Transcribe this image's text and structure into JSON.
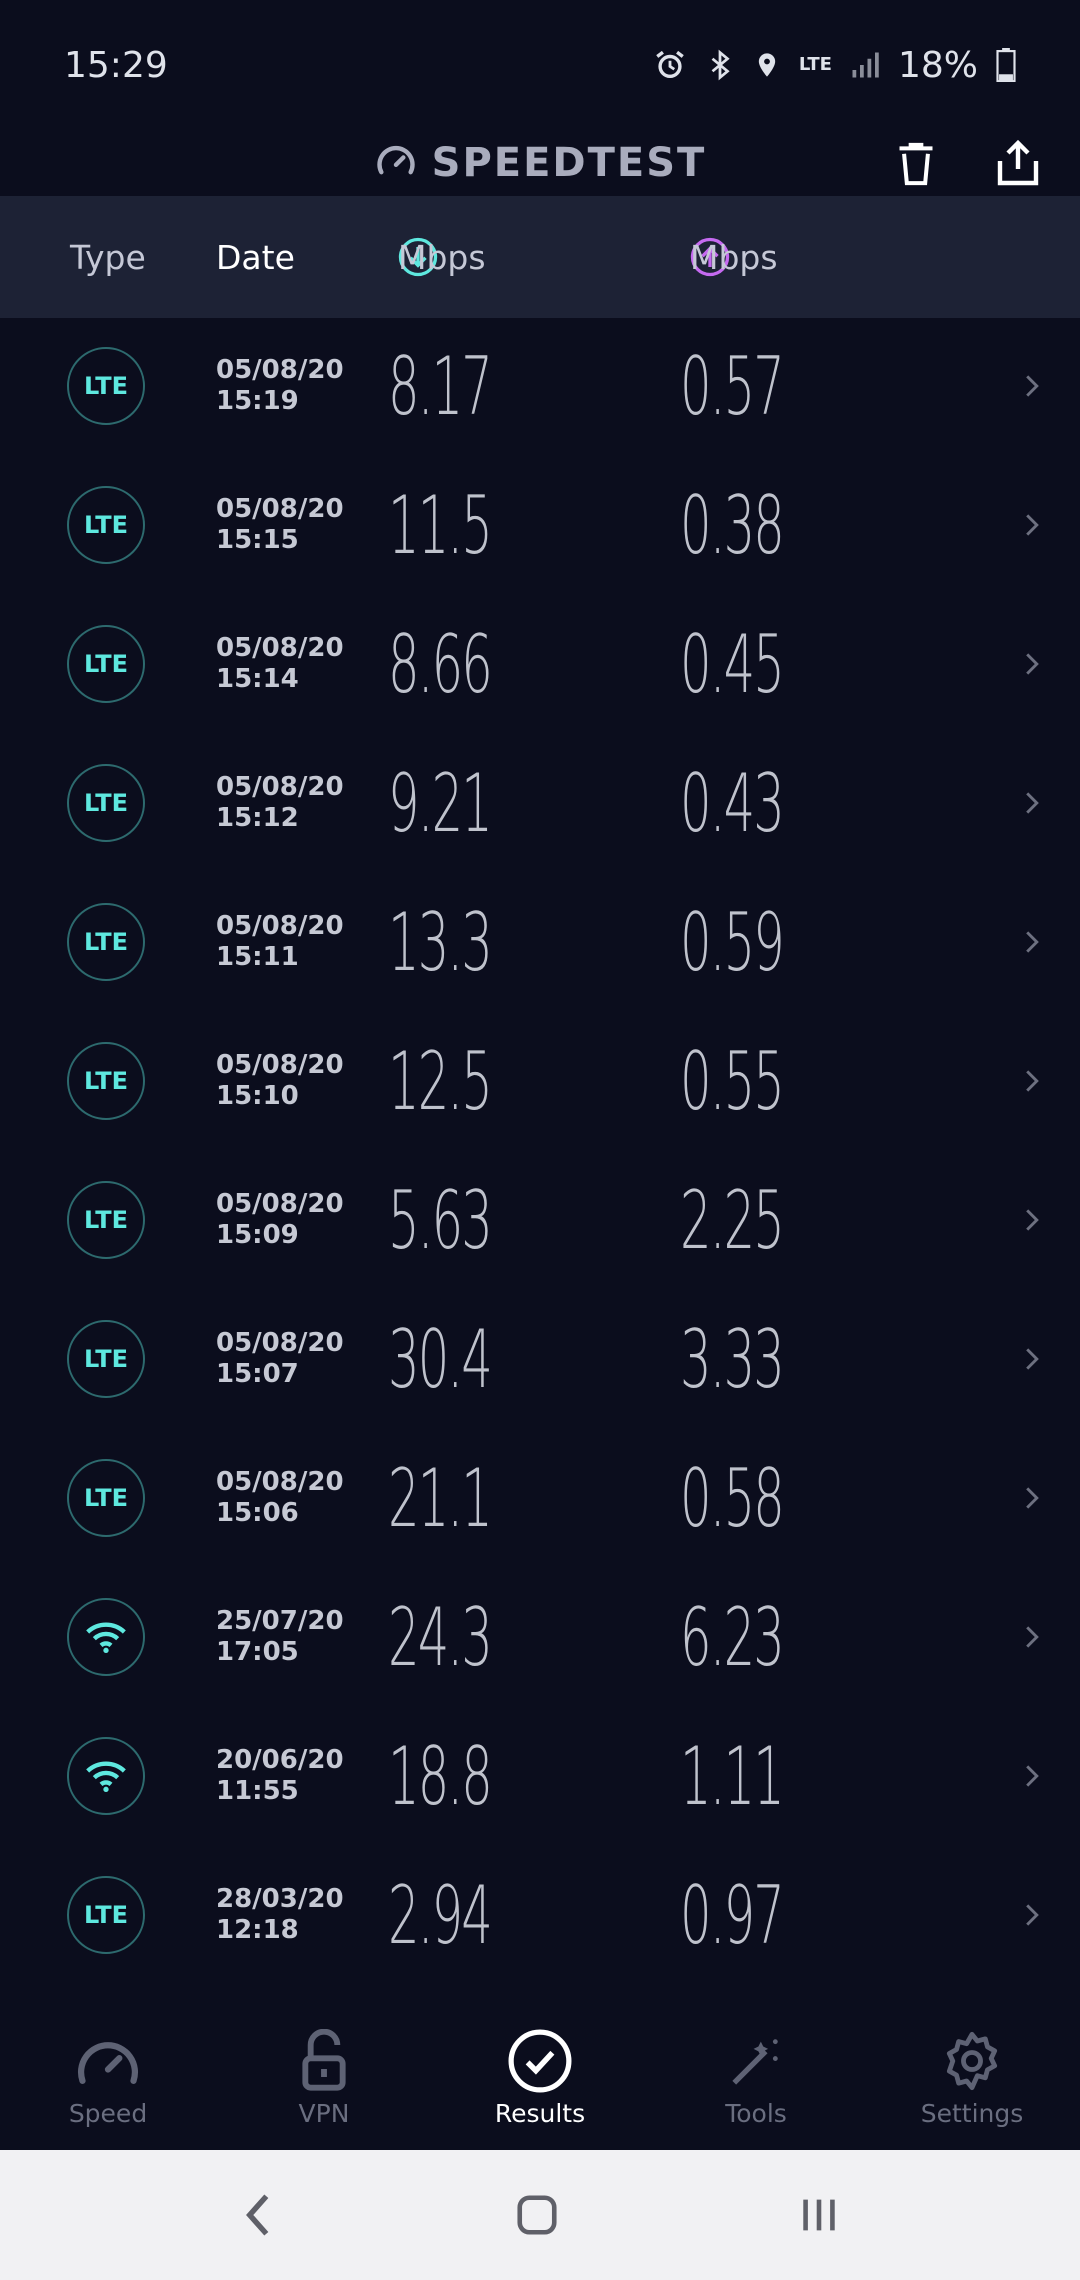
{
  "status_bar": {
    "time": "15:29",
    "network": "LTE",
    "battery": "18%"
  },
  "app": {
    "title": "SPEEDTEST"
  },
  "columns": {
    "type": "Type",
    "date": "Date",
    "download_unit": "Mbps",
    "upload_unit": "Mbps"
  },
  "results": [
    {
      "type": "LTE",
      "date": "05/08/20",
      "time": "15:19",
      "download": "8.17",
      "upload": "0.57"
    },
    {
      "type": "LTE",
      "date": "05/08/20",
      "time": "15:15",
      "download": "11.5",
      "upload": "0.38"
    },
    {
      "type": "LTE",
      "date": "05/08/20",
      "time": "15:14",
      "download": "8.66",
      "upload": "0.45"
    },
    {
      "type": "LTE",
      "date": "05/08/20",
      "time": "15:12",
      "download": "9.21",
      "upload": "0.43"
    },
    {
      "type": "LTE",
      "date": "05/08/20",
      "time": "15:11",
      "download": "13.3",
      "upload": "0.59"
    },
    {
      "type": "LTE",
      "date": "05/08/20",
      "time": "15:10",
      "download": "12.5",
      "upload": "0.55"
    },
    {
      "type": "LTE",
      "date": "05/08/20",
      "time": "15:09",
      "download": "5.63",
      "upload": "2.25"
    },
    {
      "type": "LTE",
      "date": "05/08/20",
      "time": "15:07",
      "download": "30.4",
      "upload": "3.33"
    },
    {
      "type": "LTE",
      "date": "05/08/20",
      "time": "15:06",
      "download": "21.1",
      "upload": "0.58"
    },
    {
      "type": "wifi",
      "date": "25/07/20",
      "time": "17:05",
      "download": "24.3",
      "upload": "6.23"
    },
    {
      "type": "wifi",
      "date": "20/06/20",
      "time": "11:55",
      "download": "18.8",
      "upload": "1.11"
    },
    {
      "type": "LTE",
      "date": "28/03/20",
      "time": "12:18",
      "download": "2.94",
      "upload": "0.97"
    }
  ],
  "tabs": [
    {
      "label": "Speed",
      "icon": "speedometer-icon"
    },
    {
      "label": "VPN",
      "icon": "unlock-icon"
    },
    {
      "label": "Results",
      "icon": "check-circle-icon",
      "active": true
    },
    {
      "label": "Tools",
      "icon": "magic-wand-icon"
    },
    {
      "label": "Settings",
      "icon": "gear-icon"
    }
  ],
  "colors": {
    "background": "#0b0d1d",
    "header": "#1d2235",
    "accent_download": "#5ee8df",
    "accent_upload": "#c56af0"
  }
}
